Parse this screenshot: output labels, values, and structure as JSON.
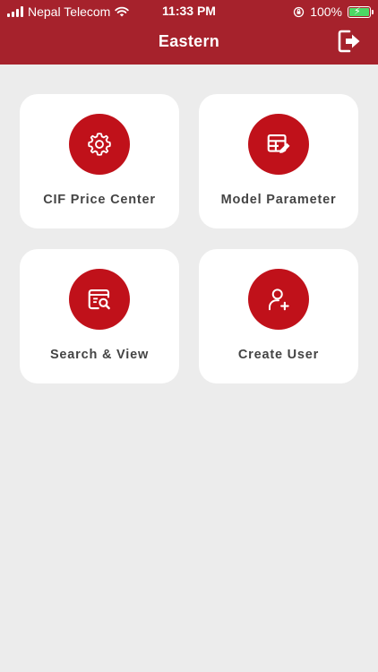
{
  "status_bar": {
    "carrier": "Nepal Telecom",
    "time": "11:33 PM",
    "battery_percent": "100%"
  },
  "header": {
    "title": "Eastern",
    "background_color": "#a6222c"
  },
  "menu": {
    "items": [
      {
        "label": "CIF Price Center",
        "icon": "gear-icon"
      },
      {
        "label": "Model Parameter",
        "icon": "table-edit-icon"
      },
      {
        "label": "Search & View",
        "icon": "document-search-icon"
      },
      {
        "label": "Create User",
        "icon": "user-add-icon"
      }
    ],
    "accent_color": "#c0111a"
  }
}
